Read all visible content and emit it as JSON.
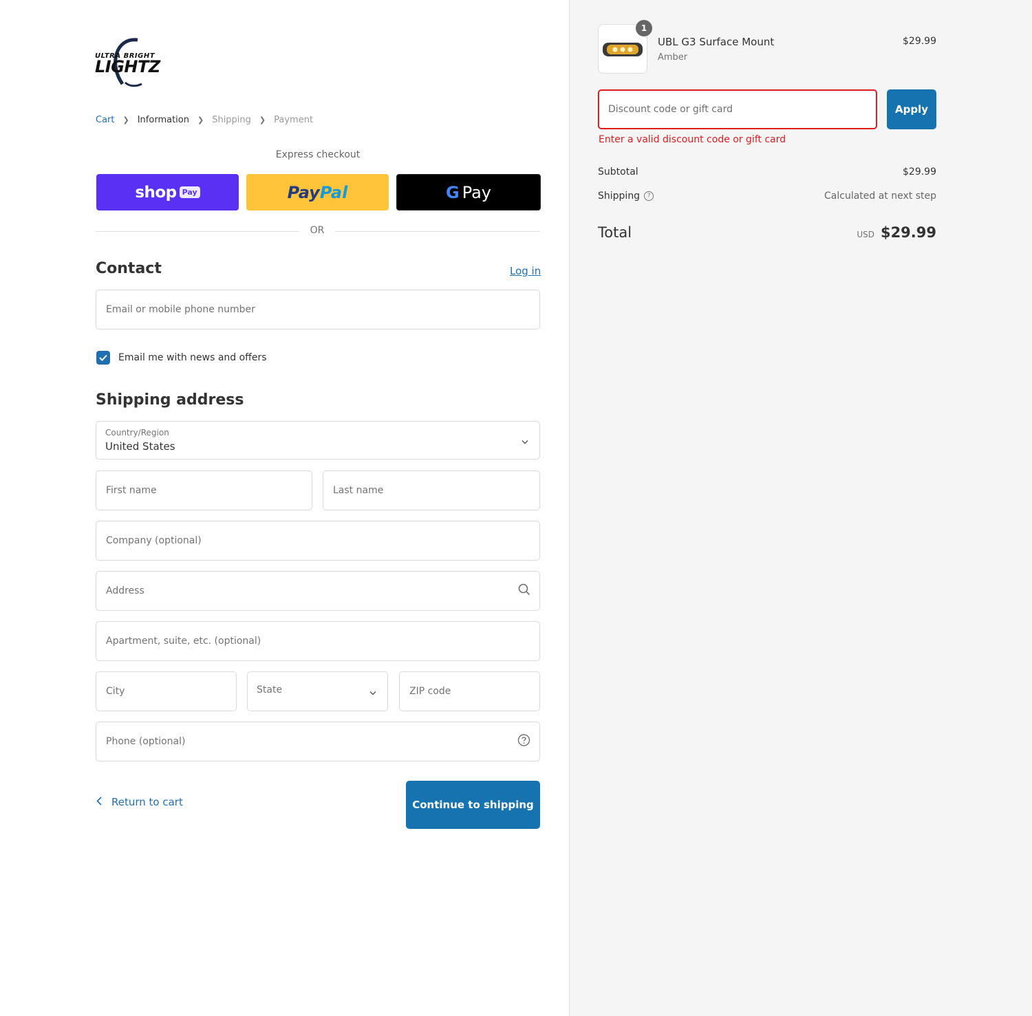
{
  "brand": {
    "logo_line1": "ULTRA BRIGHT",
    "logo_line2": "LIGHTZ"
  },
  "breadcrumb": {
    "cart": "Cart",
    "information": "Information",
    "shipping": "Shipping",
    "payment": "Payment"
  },
  "express": {
    "label": "Express checkout",
    "shop_pay_word": "shop",
    "shop_pay_pill": "Pay",
    "paypal_part1": "Pay",
    "paypal_part2": "Pal",
    "gpay_g": "G",
    "gpay_word": "Pay",
    "or": "OR"
  },
  "contact": {
    "title": "Contact",
    "login": "Log in",
    "email_placeholder": "Email or mobile phone number",
    "newsletter_label": "Email me with news and offers",
    "newsletter_checked": true
  },
  "shipping_address": {
    "title": "Shipping address",
    "country_label": "Country/Region",
    "country_value": "United States",
    "first_name_placeholder": "First name",
    "last_name_placeholder": "Last name",
    "company_placeholder": "Company (optional)",
    "address_placeholder": "Address",
    "apartment_placeholder": "Apartment, suite, etc. (optional)",
    "city_placeholder": "City",
    "state_label": "State",
    "zip_placeholder": "ZIP code",
    "phone_placeholder": "Phone (optional)"
  },
  "footer": {
    "return_label": "Return to cart",
    "continue_label": "Continue to shipping"
  },
  "order": {
    "quantity": "1",
    "product_name": "UBL G3 Surface Mount",
    "product_variant": "Amber",
    "product_price": "$29.99",
    "discount_placeholder": "Discount code or gift card",
    "apply_label": "Apply",
    "discount_error": "Enter a valid discount code or gift card",
    "subtotal_label": "Subtotal",
    "subtotal_value": "$29.99",
    "shipping_label": "Shipping",
    "shipping_value": "Calculated at next step",
    "total_label": "Total",
    "total_currency": "USD",
    "total_value": "$29.99"
  },
  "colors": {
    "accent": "#1773b0",
    "error": "#dd1d1d",
    "shop_pay": "#5a31f4",
    "paypal": "#ffc439",
    "summary_bg": "#f5f5f5"
  }
}
